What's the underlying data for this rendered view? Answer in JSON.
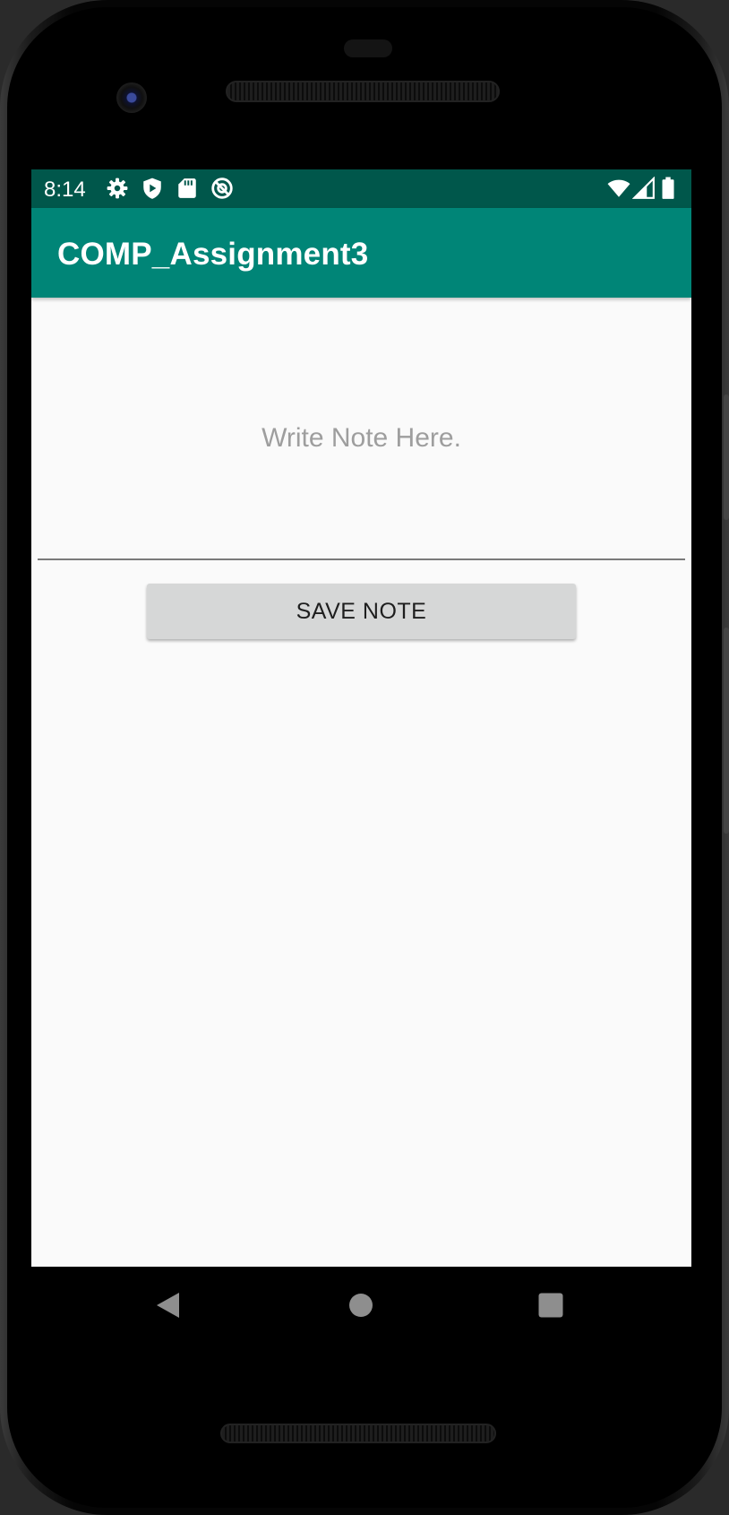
{
  "status_bar": {
    "time": "8:14",
    "background": "#00574b",
    "left_icons": [
      "settings-icon",
      "shield-icon",
      "sd-card-icon",
      "at-sign-icon"
    ],
    "right_icons": [
      "wifi-icon",
      "cellular-signal-icon",
      "battery-icon"
    ]
  },
  "app_bar": {
    "title": "COMP_Assignment3",
    "background": "#008577"
  },
  "note": {
    "value": "",
    "placeholder": "Write Note Here."
  },
  "save_button": {
    "label": "SAVE NOTE"
  },
  "nav_bar": {
    "buttons": [
      "back-icon",
      "home-icon",
      "recents-icon"
    ]
  }
}
